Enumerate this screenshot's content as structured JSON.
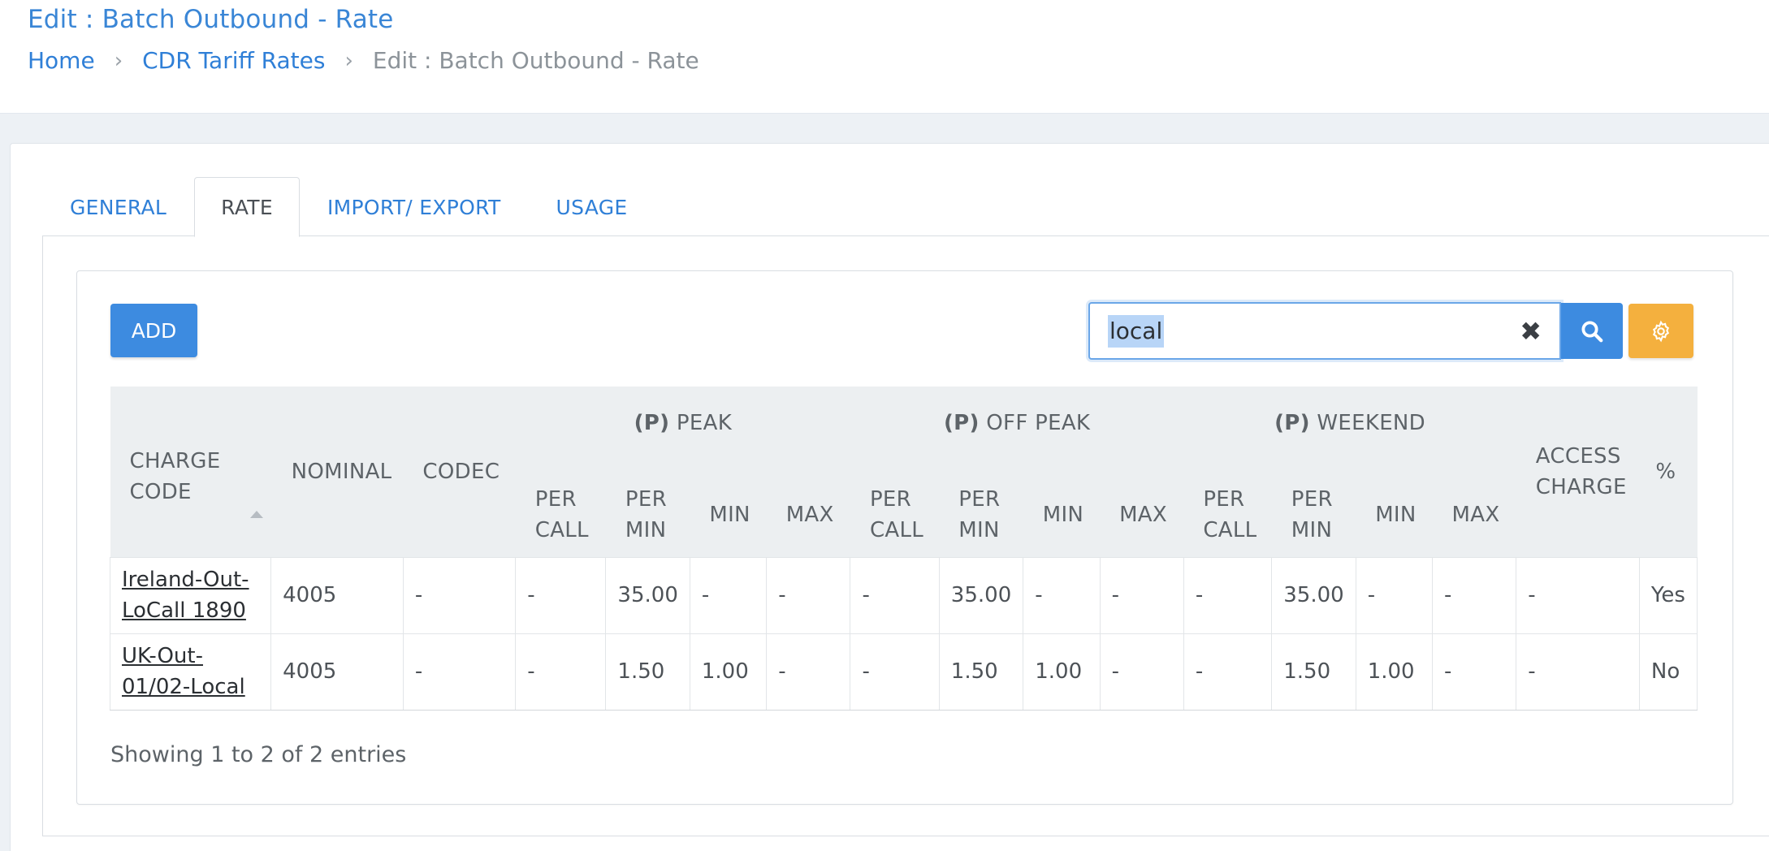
{
  "header": {
    "title": "Edit : Batch Outbound - Rate",
    "breadcrumb": {
      "home": "Home",
      "parent": "CDR Tariff Rates",
      "current": "Edit : Batch Outbound - Rate"
    }
  },
  "tabs": [
    {
      "label": "GENERAL"
    },
    {
      "label": "RATE"
    },
    {
      "label": "IMPORT/ EXPORT"
    },
    {
      "label": "USAGE"
    }
  ],
  "toolbar": {
    "add_label": "ADD",
    "search_value": "local",
    "clear_symbol": "✖",
    "search_icon": "search-icon",
    "settings_icon": "gear-icon",
    "colors": {
      "primary": "#3d8be0",
      "settings": "#f4b03e",
      "link": "#2f7fd7"
    }
  },
  "table": {
    "headers": {
      "charge_code_1": "CHARGE",
      "charge_code_2": "CODE",
      "nominal": "NOMINAL",
      "codec": "CODEC",
      "peak_prefix": "(p)",
      "peak": "PEAK",
      "offpeak_prefix": "(p)",
      "offpeak": "OFF PEAK",
      "weekend_prefix": "(p)",
      "weekend": "WEEKEND",
      "access_charge_1": "ACCESS",
      "access_charge_2": "CHARGE",
      "percent": "%",
      "per_call_1": "PER",
      "per_call_2": "CALL",
      "per_min_1": "PER",
      "per_min_2": "MIN",
      "min": "MIN",
      "max": "MAX"
    },
    "rows": [
      {
        "charge_code_1": "Ireland-Out-",
        "charge_code_2": "LoCall 1890",
        "nominal": "4005",
        "codec": "-",
        "peak_per_call": "-",
        "peak_per_min": "35.00",
        "peak_min": "-",
        "peak_max": "-",
        "offpeak_per_call": "-",
        "offpeak_per_min": "35.00",
        "offpeak_min": "-",
        "offpeak_max": "-",
        "weekend_per_call": "-",
        "weekend_per_min": "35.00",
        "weekend_min": "-",
        "weekend_max": "-",
        "access_charge": "-",
        "percent": "Yes"
      },
      {
        "charge_code_1": "UK-Out-",
        "charge_code_2": "01/02-Local",
        "nominal": "4005",
        "codec": "-",
        "peak_per_call": "-",
        "peak_per_min": "1.50",
        "peak_min": "1.00",
        "peak_max": "-",
        "offpeak_per_call": "-",
        "offpeak_per_min": "1.50",
        "offpeak_min": "1.00",
        "offpeak_max": "-",
        "weekend_per_call": "-",
        "weekend_per_min": "1.50",
        "weekend_min": "1.00",
        "weekend_max": "-",
        "access_charge": "-",
        "percent": "No"
      }
    ],
    "info": "Showing 1 to 2 of 2 entries"
  }
}
